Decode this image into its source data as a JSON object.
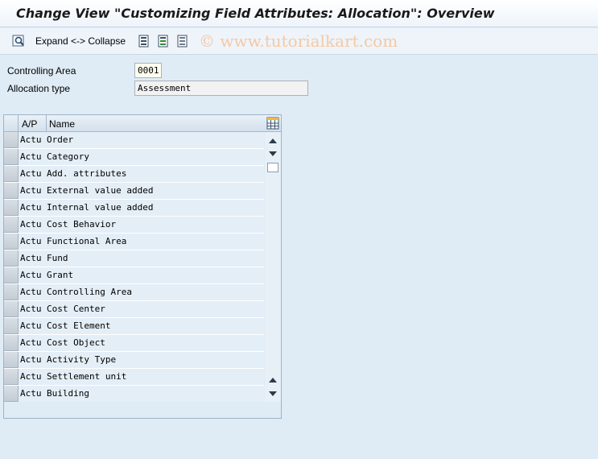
{
  "window": {
    "title": "Change View \"Customizing Field Attributes: Allocation\": Overview"
  },
  "toolbar": {
    "expand_collapse_label": "Expand <-> Collapse",
    "watermark": "© www.tutorialkart.com",
    "icons": [
      "display-change-icon",
      "select-all-icon",
      "select-block-icon",
      "deselect-all-icon"
    ]
  },
  "fields": {
    "controlling_area_label": "Controlling Area",
    "controlling_area_value": "0001",
    "allocation_type_label": "Allocation type",
    "allocation_type_value": "Assessment"
  },
  "table": {
    "columns": [
      "A/P",
      "Name"
    ],
    "rows": [
      {
        "ap": "Actu",
        "name": "Order"
      },
      {
        "ap": "Actu",
        "name": "Category"
      },
      {
        "ap": "Actu",
        "name": "Add. attributes"
      },
      {
        "ap": "Actu",
        "name": "External value added"
      },
      {
        "ap": "Actu",
        "name": "Internal value added"
      },
      {
        "ap": "Actu",
        "name": "Cost Behavior"
      },
      {
        "ap": "Actu",
        "name": "Functional Area"
      },
      {
        "ap": "Actu",
        "name": "Fund"
      },
      {
        "ap": "Actu",
        "name": "Grant"
      },
      {
        "ap": "Actu",
        "name": "Controlling Area"
      },
      {
        "ap": "Actu",
        "name": "Cost Center"
      },
      {
        "ap": "Actu",
        "name": "Cost Element"
      },
      {
        "ap": "Actu",
        "name": "Cost Object"
      },
      {
        "ap": "Actu",
        "name": "Activity Type"
      },
      {
        "ap": "Actu",
        "name": "Settlement unit"
      },
      {
        "ap": "Actu",
        "name": "Building"
      }
    ]
  },
  "colors": {
    "background": "#dfebf5",
    "row_background": "#e4eef7",
    "watermark": "#f4c9a6"
  }
}
